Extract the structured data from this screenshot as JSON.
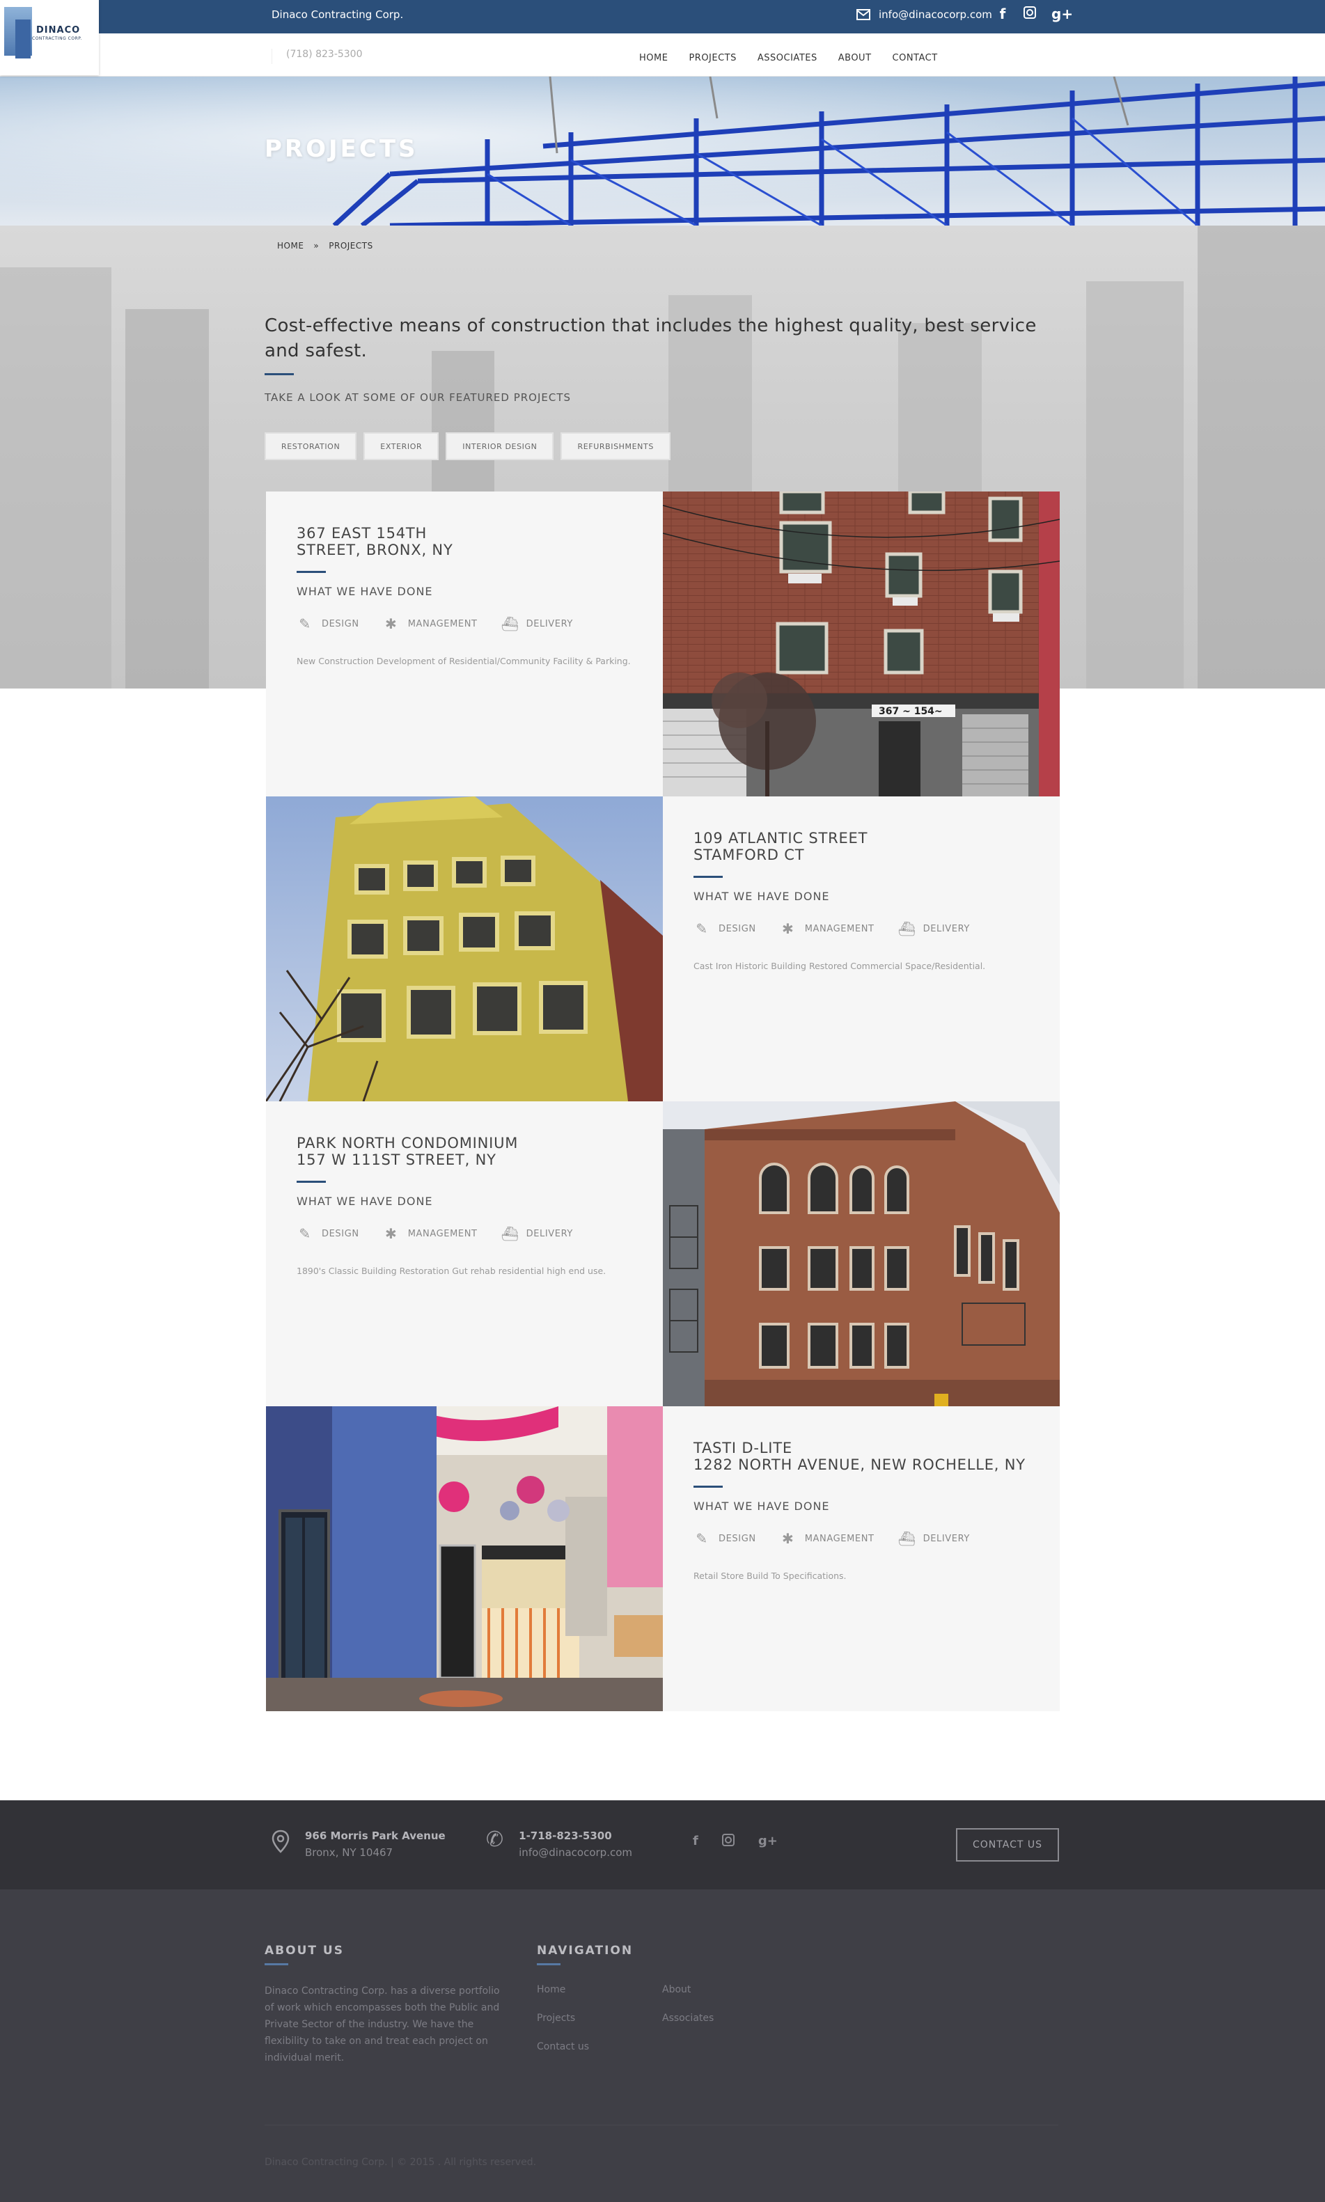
{
  "header": {
    "company": "Dinaco Contracting Corp.",
    "email": "info@dinacocorp.com",
    "social_icons": [
      "facebook-icon",
      "instagram-icon",
      "google-plus-icon"
    ],
    "phone": "(718) 823-5300",
    "logo_name": "DINACO",
    "logo_sub": "CONTRACTING CORP."
  },
  "nav": {
    "items": [
      "HOME",
      "PROJECTS",
      "ASSOCIATES",
      "ABOUT",
      "CONTACT"
    ]
  },
  "hero": {
    "title": "PROJECTS"
  },
  "breadcrumb": {
    "home": "HOME",
    "separator": "»",
    "current": "PROJECTS"
  },
  "intro": {
    "headline": "Cost-effective means of construction that includes the highest quality, best service and safest.",
    "featured": "TAKE A LOOK AT SOME OF OUR FEATURED PROJECTS",
    "filters": [
      "RESTORATION",
      "EXTERIOR",
      "INTERIOR DESIGN",
      "REFURBISHMENTS"
    ]
  },
  "projects": [
    {
      "title_line1": "367 EAST 154TH",
      "title_line2": "STREET, BRONX, NY",
      "what": "WHAT WE HAVE DONE",
      "services": [
        "DESIGN",
        "MANAGEMENT",
        "DELIVERY"
      ],
      "description": "New Construction Development of Residential/Community Facility & Parking."
    },
    {
      "title_line1": "109 ATLANTIC STREET",
      "title_line2": "STAMFORD CT",
      "what": "WHAT WE HAVE DONE",
      "services": [
        "DESIGN",
        "MANAGEMENT",
        "DELIVERY"
      ],
      "description": "Cast Iron Historic Building Restored Commercial Space/Residential."
    },
    {
      "title_line1": "PARK NORTH CONDOMINIUM",
      "title_line2": "157 W 111ST STREET, NY",
      "what": "WHAT WE HAVE DONE",
      "services": [
        "DESIGN",
        "MANAGEMENT",
        "DELIVERY"
      ],
      "description": "1890's Classic Building Restoration Gut rehab residential high end use."
    },
    {
      "title_line1": "TASTI D-LITE",
      "title_line2": "1282 NORTH AVENUE, NEW ROCHELLE, NY",
      "what": "WHAT WE HAVE DONE",
      "services": [
        "DESIGN",
        "MANAGEMENT",
        "DELIVERY"
      ],
      "description": "Retail Store Build To Specifications."
    }
  ],
  "photo_labels": {
    "storefront_sign": "367 ~ 154~"
  },
  "footer_top": {
    "address_line1": "966 Morris Park Avenue",
    "address_line2": "Bronx, NY 10467",
    "phone": "1-718-823-5300",
    "email": "info@dinacocorp.com",
    "contact_button": "CONTACT US"
  },
  "footer": {
    "about_heading": "ABOUT US",
    "about_text": "Dinaco Contracting Corp. has a diverse portfolio of work which encompasses both the Public and Private Sector of the industry. We have the flexibility to take on and treat each project on individual merit.",
    "nav_heading": "NAVIGATION",
    "nav_col1": [
      "Home",
      "Projects",
      "Contact us"
    ],
    "nav_col2": [
      "About",
      "Associates"
    ],
    "copyright": "Dinaco Contracting Corp. | © 2015 . All rights reserved."
  },
  "colors": {
    "brand_blue": "#2b4f7a",
    "footer_dark": "#323237",
    "footer_main": "#3f3f46"
  }
}
